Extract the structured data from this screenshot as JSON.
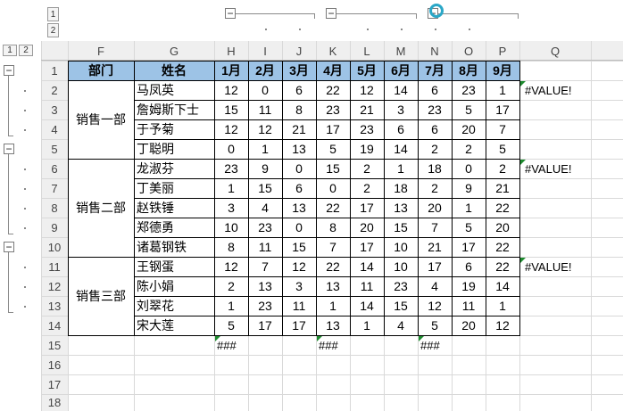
{
  "outline_level_buttons": [
    "1",
    "2"
  ],
  "column_headers": [
    "F",
    "G",
    "H",
    "I",
    "J",
    "K",
    "L",
    "M",
    "N",
    "O",
    "P",
    "Q"
  ],
  "row_headers": [
    "1",
    "2",
    "3",
    "4",
    "5",
    "6",
    "7",
    "8",
    "9",
    "10",
    "11",
    "12",
    "13",
    "14",
    "15",
    "16",
    "17",
    "18"
  ],
  "header_row": [
    "部门",
    "姓名",
    "1月",
    "2月",
    "3月",
    "4月",
    "5月",
    "6月",
    "7月",
    "8月",
    "9月"
  ],
  "header_fill_color": "#9dc3e6",
  "groups": [
    {
      "dept": "销售一部",
      "check": "#VALUE!",
      "rows": [
        {
          "name": "马凤英",
          "values": [
            12,
            0,
            6,
            22,
            12,
            14,
            6,
            23,
            1
          ]
        },
        {
          "name": "詹姆斯下士",
          "values": [
            15,
            11,
            8,
            23,
            21,
            3,
            23,
            5,
            17
          ]
        },
        {
          "name": "于予菊",
          "values": [
            12,
            12,
            21,
            17,
            23,
            6,
            6,
            20,
            7
          ]
        },
        {
          "name": "丁聪明",
          "values": [
            0,
            1,
            13,
            5,
            19,
            14,
            2,
            2,
            5
          ]
        }
      ]
    },
    {
      "dept": "销售二部",
      "check": "#VALUE!",
      "rows": [
        {
          "name": "龙淑芬",
          "values": [
            23,
            9,
            0,
            15,
            2,
            1,
            18,
            0,
            2
          ]
        },
        {
          "name": "丁美丽",
          "values": [
            1,
            15,
            6,
            0,
            2,
            18,
            2,
            9,
            21
          ]
        },
        {
          "name": "赵铁锤",
          "values": [
            3,
            4,
            13,
            22,
            17,
            13,
            20,
            1,
            22
          ]
        },
        {
          "name": "郑德勇",
          "values": [
            10,
            23,
            0,
            8,
            20,
            15,
            7,
            5,
            20
          ]
        },
        {
          "name": "诸葛钢铁",
          "values": [
            8,
            11,
            15,
            7,
            17,
            10,
            21,
            17,
            22
          ]
        }
      ]
    },
    {
      "dept": "销售三部",
      "check": "#VALUE!",
      "rows": [
        {
          "name": "王钢蛋",
          "values": [
            12,
            7,
            12,
            22,
            14,
            10,
            17,
            6,
            22
          ]
        },
        {
          "name": "陈小娟",
          "values": [
            2,
            13,
            3,
            13,
            11,
            23,
            4,
            19,
            14
          ]
        },
        {
          "name": "刘翠花",
          "values": [
            1,
            23,
            11,
            1,
            14,
            15,
            12,
            11,
            1
          ]
        },
        {
          "name": "宋大莲",
          "values": [
            5,
            17,
            17,
            13,
            1,
            4,
            5,
            20,
            12
          ]
        }
      ]
    }
  ],
  "row15": {
    "H": "###",
    "K": "###",
    "N": "###"
  },
  "col_group_toggle": "−",
  "row_group_toggle": "−"
}
